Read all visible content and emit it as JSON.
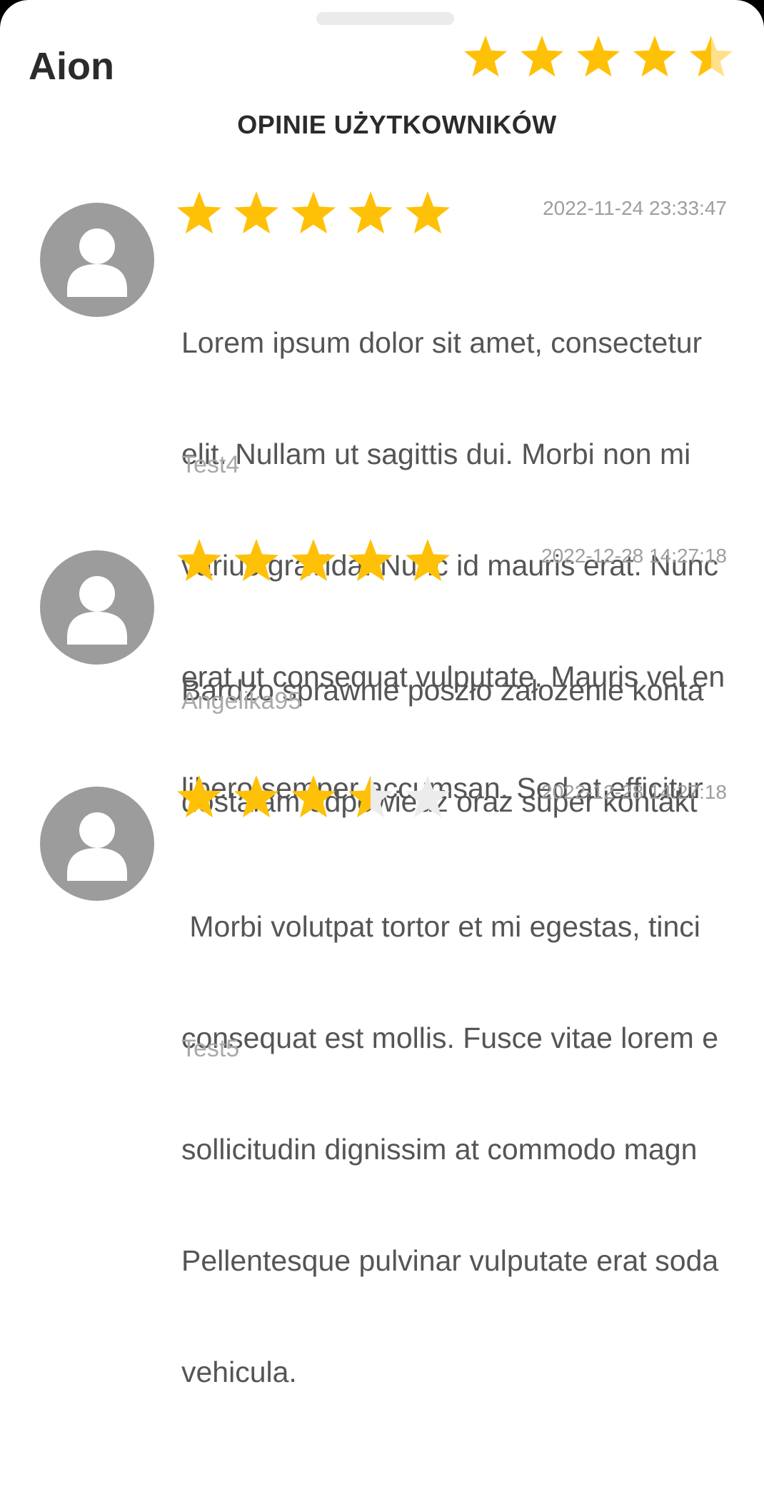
{
  "app": {
    "name": "Aion",
    "rating_stars": 4.5
  },
  "section": {
    "title": "OPINIE UŻYTKOWNIKÓW"
  },
  "colors": {
    "star_filled": "#ffc107",
    "star_empty": "#ececec",
    "header_star_half_light": "#ffe08a",
    "avatar_bg": "#9c9c9c"
  },
  "icons": {
    "avatar": "user-icon",
    "rating": "star-icon"
  },
  "reviews": [
    {
      "date": "2022-11-24 23:33:47",
      "stars": 5,
      "text_lines": [
        "Lorem ipsum dolor sit amet, consectetur",
        "elit. Nullam ut sagittis dui. Morbi non mi",
        "varius gravida. Nunc id mauris erat. Nunc",
        "erat ut consequat vulputate. Mauris vel en",
        "libero semper accumsan. Sed at efficitur"
      ],
      "author": "Test4"
    },
    {
      "date": "2022-12-28 14:27:18",
      "stars": 5,
      "text_lines": [
        "Bardzo sprawnie poszło założenie konta",
        "dostałam odpowiedź oraz super kontakt"
      ],
      "author": "Angelika95"
    },
    {
      "date": "2022-12-28 14:27:18",
      "stars": 3.5,
      "text_lines": [
        " Morbi volutpat tortor et mi egestas, tinci",
        "consequat est mollis. Fusce vitae lorem e",
        "sollicitudin dignissim at commodo magn",
        "Pellentesque pulvinar vulputate erat soda",
        "vehicula."
      ],
      "author": "Test5"
    }
  ]
}
